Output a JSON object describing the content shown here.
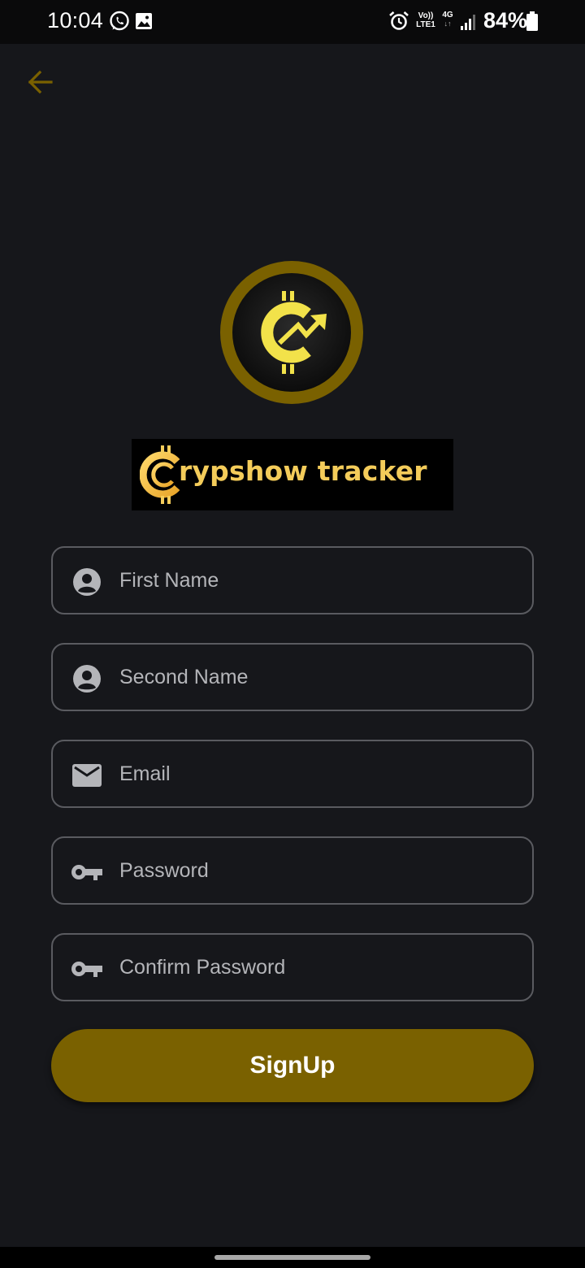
{
  "status_bar": {
    "time": "10:04",
    "volte_line1": "Vo))",
    "volte_line2": "LTE1",
    "network": "4G",
    "network_arrows": "↓↑",
    "battery_percent": "84%"
  },
  "brand": {
    "name": "rypshow tracker",
    "accent_color": "#f4cc5a",
    "logo_ring_color": "#7a6100"
  },
  "form": {
    "first_name": {
      "placeholder": "First Name",
      "value": "",
      "icon": "person-icon"
    },
    "second_name": {
      "placeholder": "Second Name",
      "value": "",
      "icon": "person-icon"
    },
    "email": {
      "placeholder": "Email",
      "value": "",
      "icon": "mail-icon"
    },
    "password": {
      "placeholder": "Password",
      "value": "",
      "icon": "key-icon"
    },
    "confirm_password": {
      "placeholder": "Confirm Password",
      "value": "",
      "icon": "key-icon"
    }
  },
  "signup_button": {
    "label": "SignUp",
    "color": "#7a6100"
  }
}
